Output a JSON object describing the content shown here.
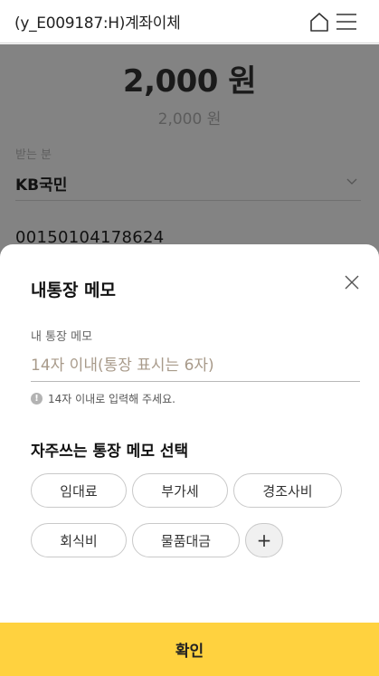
{
  "header": {
    "title": "(y_E009187:H)계좌이체",
    "home_icon": "home-icon",
    "menu_icon": "hamburger-menu-icon"
  },
  "transfer": {
    "amount": "2,000 원",
    "amount_sub": "2,000 원",
    "recipient_label": "받는 분",
    "bank": "KB국민",
    "account_number": "00150104178624"
  },
  "memo_sheet": {
    "title": "내통장 메모",
    "field_label": "내 통장 메모",
    "placeholder": "14자 이내(통장 표시는 6자)",
    "value": "",
    "hint": "14자 이내로 입력해 주세요.",
    "favorites_title": "자주쓰는 통장 메모 선택",
    "chips": [
      "임대료",
      "부가세",
      "경조사비",
      "회식비",
      "물품대금"
    ],
    "add_label": "+"
  },
  "confirm_label": "확인",
  "colors": {
    "accent": "#ffd23f",
    "overlay": "#838383",
    "placeholder": "#a89a8a"
  }
}
